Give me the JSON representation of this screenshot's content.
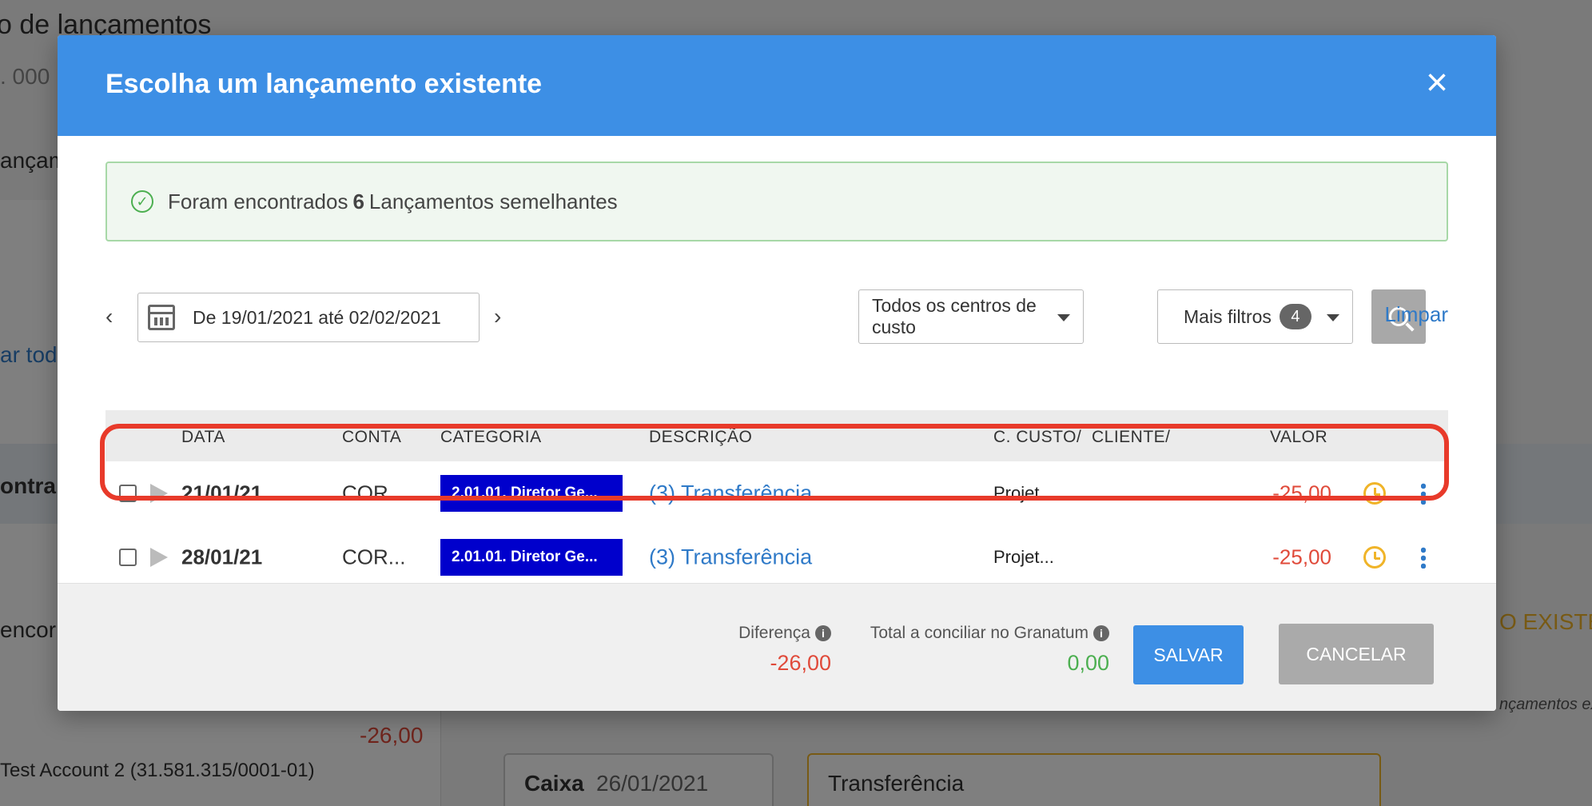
{
  "background": {
    "title_fragment": "o de lançamentos",
    "code_fragment": ". 000",
    "tab_fragment": "ançam",
    "link_fragment": "ar tod",
    "section_fragment": "ontra",
    "found_fragment": "encor",
    "amount": "-26,00",
    "account": "Test Account 2 (31.581.315/0001-01)",
    "button_fragment": "O EXISTEN",
    "note_fragment": "nçamentos ex",
    "card_label": "Caixa",
    "card_date": "26/01/2021",
    "card_desc": "Transferência"
  },
  "modal": {
    "title": "Escolha um lançamento existente",
    "close_symbol": "×",
    "alert": {
      "prefix": "Foram encontrados",
      "count": "6",
      "suffix": "Lançamentos semelhantes"
    },
    "filters": {
      "prev": "‹",
      "next": "›",
      "date_range": "De 19/01/2021 até 02/02/2021",
      "cost_center": "Todos os centros de custo",
      "more_filters": "Mais filtros",
      "more_filters_count": "4",
      "clear": "Limpar"
    },
    "table": {
      "headers": [
        "DATA",
        "CONTA",
        "CATEGORIA",
        "DESCRIÇÃO",
        "C. CUSTO/",
        "CLIENTE/",
        "VALOR"
      ],
      "rows": [
        {
          "date": "21/01/21",
          "account": "COR...",
          "category": "2.01.01. Diretor Ge...",
          "description": "(3) Transferência",
          "cost_center": "Projet...",
          "value": "-25,00"
        },
        {
          "date": "28/01/21",
          "account": "COR...",
          "category": "2.01.01. Diretor Ge...",
          "description": "(3) Transferência",
          "cost_center": "Projet...",
          "value": "-25,00"
        }
      ]
    },
    "footer": {
      "difference_label": "Diferença",
      "difference_value": "-26,00",
      "total_label": "Total a conciliar no Granatum",
      "total_value": "0,00",
      "save": "SALVAR",
      "cancel": "CANCELAR"
    }
  },
  "colors": {
    "header_blue": "#3d8fe5",
    "negative": "#e04a3a",
    "positive": "#4caf50",
    "category_bg": "#0000cc",
    "highlight": "#e83a2a"
  }
}
